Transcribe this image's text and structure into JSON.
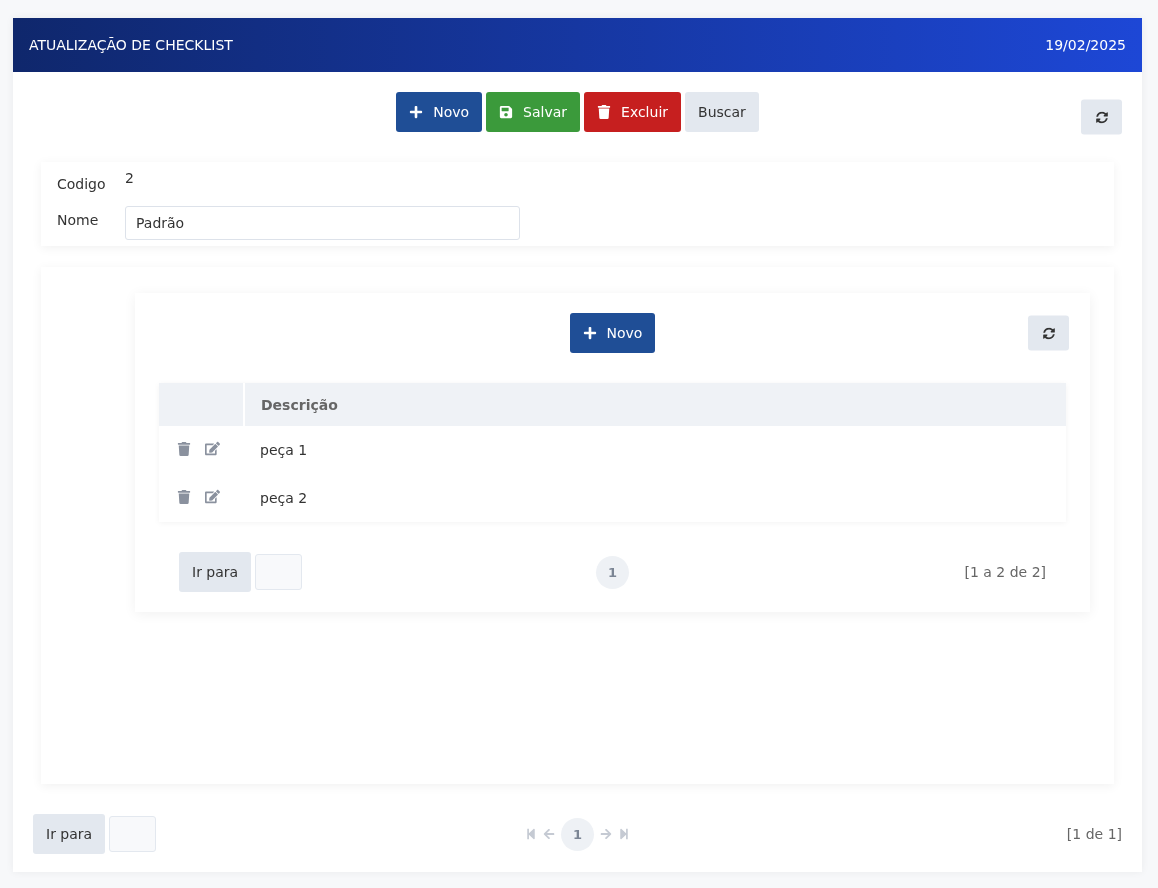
{
  "header": {
    "title": "ATUALIZAÇÃO DE CHECKLIST",
    "date": "19/02/2025"
  },
  "toolbar": {
    "buttons": [
      {
        "kind": "new",
        "label": "Novo"
      },
      {
        "kind": "save",
        "label": "Salvar"
      },
      {
        "kind": "delete",
        "label": "Excluir"
      },
      {
        "kind": "search",
        "label": "Buscar"
      }
    ]
  },
  "form": {
    "fields": [
      {
        "kind": "text",
        "label": "Codigo",
        "value": "2"
      },
      {
        "kind": "input",
        "label": "Nome",
        "value": "Padrão"
      }
    ]
  },
  "detail": {
    "toolbar": {
      "buttons": [
        {
          "kind": "new",
          "label": "Novo"
        }
      ]
    },
    "table": {
      "columns": [
        "Descrição"
      ],
      "rows": [
        {
          "cells": [
            "peça 1"
          ]
        },
        {
          "cells": [
            "peça 2"
          ]
        }
      ]
    },
    "pager": {
      "goto_label": "Ir para",
      "show_nav": false,
      "pages": [
        {
          "label": "1",
          "selected": true
        }
      ],
      "summary": "[1 a 2 de 2]"
    }
  },
  "pager": {
    "goto_label": "Ir para",
    "nav_disabled": true,
    "show_nav": true,
    "pages": [
      {
        "label": "1",
        "selected": true
      }
    ],
    "summary": "[1 de 1]"
  }
}
